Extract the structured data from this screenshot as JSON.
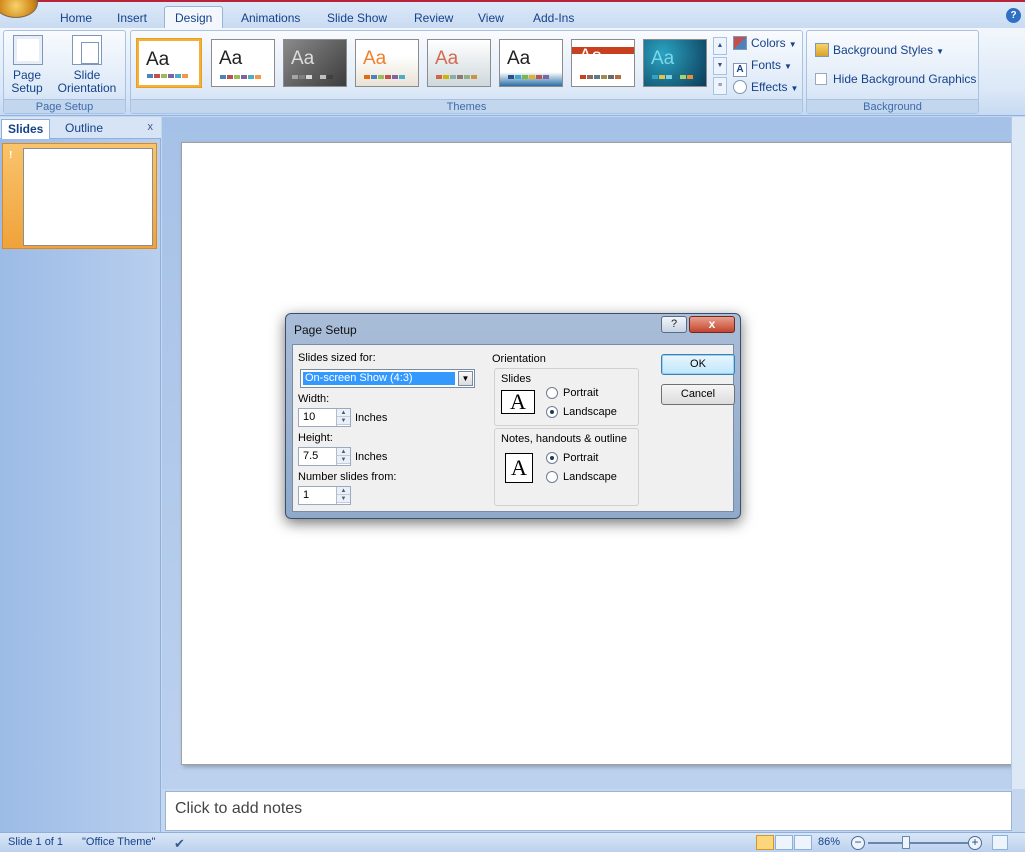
{
  "tabs": [
    "Home",
    "Insert",
    "Design",
    "Animations",
    "Slide Show",
    "Review",
    "View",
    "Add-Ins"
  ],
  "active_tab": "Design",
  "ribbon": {
    "page_setup": {
      "label": "Page Setup",
      "page_setup_btn": "Page Setup",
      "orientation_btn": "Slide Orientation"
    },
    "themes": {
      "label": "Themes",
      "sample": "Aa",
      "colors": "Colors",
      "fonts": "Fonts",
      "effects": "Effects"
    },
    "background": {
      "label": "Background",
      "styles": "Background Styles",
      "hide_graphics": "Hide Background Graphics"
    }
  },
  "leftpane": {
    "tab_slides": "Slides",
    "tab_outline": "Outline",
    "close": "x",
    "thumb_marker": "!"
  },
  "notes": {
    "placeholder": "Click to add notes"
  },
  "statusbar": {
    "slide_info": "Slide 1 of 1",
    "theme": "\"Office Theme\"",
    "zoom": "86%"
  },
  "dialog": {
    "title": "Page Setup",
    "help": "?",
    "close": "x",
    "sized_for_label": "Slides sized for:",
    "sized_for_value": "On-screen Show (4:3)",
    "width_label": "Width:",
    "width_value": "10",
    "width_unit": "Inches",
    "height_label": "Height:",
    "height_value": "7.5",
    "height_unit": "Inches",
    "number_from_label": "Number slides from:",
    "number_from_value": "1",
    "orientation_label": "Orientation",
    "slides_label": "Slides",
    "notes_label": "Notes, handouts & outline",
    "portrait": "Portrait",
    "landscape": "Landscape",
    "slides_orientation": "Landscape",
    "notes_orientation": "Portrait",
    "ok": "OK",
    "cancel": "Cancel"
  }
}
